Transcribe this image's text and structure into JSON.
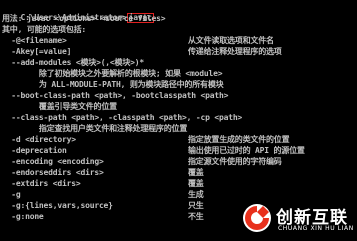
{
  "console": {
    "prompt": "C:\\Users\\Administrator>",
    "command": "javac",
    "lines": [
      {
        "left": "用法: javac <options> <source files>",
        "right": ""
      },
      {
        "left": "其中, 可能的选项包括:",
        "right": ""
      },
      {
        "left": "  -@<filename>",
        "right": "从文件读取选项和文件名"
      },
      {
        "left": "  -Akey[=value]",
        "right": "传递给注释处理程序的选项"
      },
      {
        "left": "  --add-modules <模块>(,<模块>)*",
        "right": ""
      },
      {
        "left": "        除了初始模块之外要解析的根模块; 如果 <module>",
        "right": ""
      },
      {
        "left": "        为 ALL-MODULE-PATH, 则为模块路径中的所有模块",
        "right": ""
      },
      {
        "left": "  --boot-class-path <path>, -bootclasspath <path>",
        "right": ""
      },
      {
        "left": "        覆盖引导类文件的位置",
        "right": ""
      },
      {
        "left": "  --class-path <path>, -classpath <path>, -cp <path>",
        "right": ""
      },
      {
        "left": "        指定查找用户类文件和注释处理程序的位置",
        "right": ""
      },
      {
        "left": "  -d <directory>",
        "right": "指定放置生成的类文件的位置"
      },
      {
        "left": "  -deprecation",
        "right": "输出使用已过时的 API 的源位置"
      },
      {
        "left": "  -encoding <encoding>",
        "right": "指定源文件使用的字符编码"
      },
      {
        "left": "  -endorseddirs <dirs>",
        "right": "覆盖"
      },
      {
        "left": "  -extdirs <dirs>",
        "right": "覆盖"
      },
      {
        "left": "  -g",
        "right": "生成"
      },
      {
        "left": "  -g:{lines,vars,source}",
        "right": "只生"
      },
      {
        "left": "  -g:none",
        "right": "不生"
      }
    ]
  },
  "watermark": {
    "title": "创新互联",
    "subtitle": "CHUANG XIN HU LIAN"
  },
  "colors": {
    "background": "#000000",
    "text": "#c0c0c0",
    "highlight_border": "#e02020",
    "logo_red": "#e8301c",
    "logo_white": "#ffffff"
  }
}
